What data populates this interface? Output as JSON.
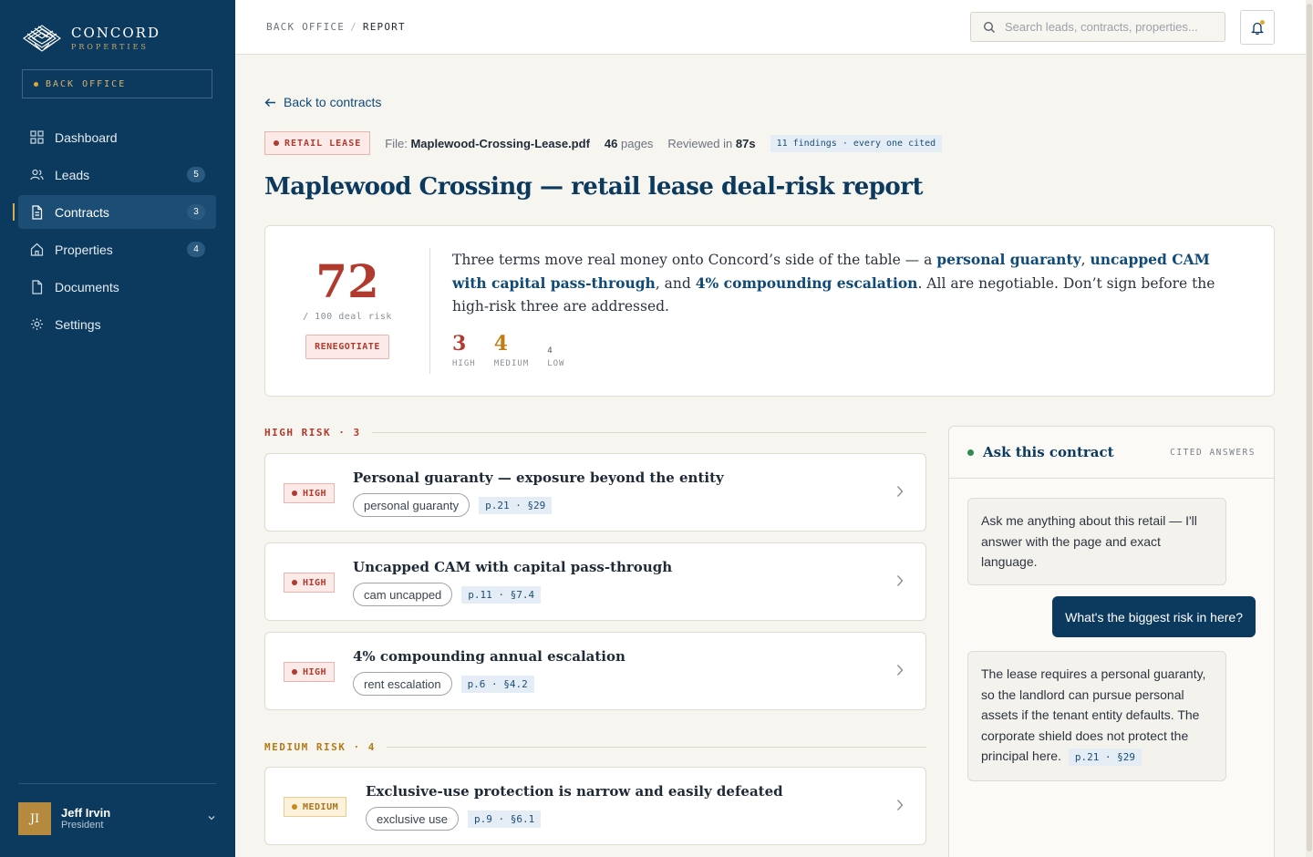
{
  "brand": {
    "name": "CONCORD",
    "sub": "PROPERTIES",
    "workspace_label": "BACK OFFICE"
  },
  "nav": {
    "items": [
      {
        "label": "Dashboard",
        "icon": "grid-icon",
        "badge": ""
      },
      {
        "label": "Leads",
        "icon": "users-icon",
        "badge": "5"
      },
      {
        "label": "Contracts",
        "icon": "document-icon",
        "badge": "3",
        "active": true
      },
      {
        "label": "Properties",
        "icon": "home-icon",
        "badge": "4"
      },
      {
        "label": "Documents",
        "icon": "file-icon",
        "badge": ""
      },
      {
        "label": "Settings",
        "icon": "gear-icon",
        "badge": ""
      }
    ]
  },
  "user": {
    "initials": "JI",
    "name": "Jeff Irvin",
    "role": "President"
  },
  "topbar": {
    "breadcrumb": [
      "BACK OFFICE",
      "REPORT"
    ],
    "search_placeholder": "Search leads, contracts, properties..."
  },
  "report": {
    "back_label": "Back to contracts",
    "type_tag": "RETAIL LEASE",
    "file_prefix": "File:",
    "file_name": "Maplewood-Crossing-Lease.pdf",
    "pages_num": "46",
    "pages_label": "pages",
    "reviewed_prefix": "Reviewed in",
    "reviewed_time": "87s",
    "findings_chip": "11 findings · every one cited",
    "title": "Maplewood Crossing — retail lease deal-risk report",
    "score": "72",
    "score_sub": "/ 100 deal risk",
    "verdict": "RENEGOTIATE",
    "summary": {
      "p1": "Three terms move real money onto Concord’s side of the table — a ",
      "h1": "personal guaranty",
      "p2": ", ",
      "h2": "uncapped CAM with capital pass-through",
      "p3": ", and ",
      "h3": "4% compounding escalation",
      "p4": ". All are negotiable. Don’t sign before the high-risk three are addressed."
    },
    "counts": [
      {
        "num": "3",
        "label": "HIGH",
        "color": "#b03a2e"
      },
      {
        "num": "4",
        "label": "MEDIUM",
        "color": "#c07d12"
      },
      {
        "num": "4",
        "label": "LOW",
        "color": "#4b5563"
      }
    ]
  },
  "sections": {
    "high_label": "HIGH RISK · 3",
    "medium_label": "MEDIUM RISK · 4"
  },
  "findings": [
    {
      "level": "HIGH",
      "title": "Personal guaranty — exposure beyond the entity",
      "tag": "personal guaranty",
      "cite": "p.21 · §29"
    },
    {
      "level": "HIGH",
      "title": "Uncapped CAM with capital pass-through",
      "tag": "cam uncapped",
      "cite": "p.11 · §7.4"
    },
    {
      "level": "HIGH",
      "title": "4% compounding annual escalation",
      "tag": "rent escalation",
      "cite": "p.6 · §4.2"
    },
    {
      "level": "MEDIUM",
      "title": "Exclusive-use protection is narrow and easily defeated",
      "tag": "exclusive use",
      "cite": "p.9 · §6.1"
    }
  ],
  "chat": {
    "title": "Ask this contract",
    "subtitle": "CITED ANSWERS",
    "bot_intro": "Ask me anything about this retail — I'll answer with the page and exact language.",
    "user_msg": "What's the biggest risk in here?",
    "bot_answer": "The lease requires a personal guaranty, so the landlord can pursue personal assets if the tenant entity defaults. The corporate shield does not protect the principal here.",
    "bot_cite": "p.21 · §29"
  },
  "colors": {
    "sidebar": "#0c3a5e",
    "accent_gold": "#d9a94a",
    "high": "#b03a2e",
    "medium": "#c07d12",
    "link": "#0f4a78"
  }
}
